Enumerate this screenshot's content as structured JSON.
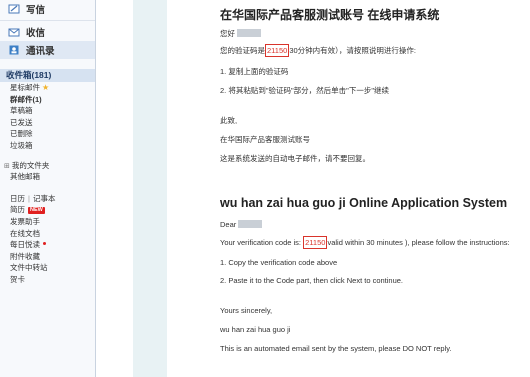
{
  "sidebar": {
    "actions": [
      {
        "label": "写信",
        "icon": "compose-icon"
      },
      {
        "label": "收信",
        "icon": "receive-icon"
      },
      {
        "label": "通讯录",
        "icon": "contacts-icon"
      }
    ],
    "inbox_label": "收件箱(181)",
    "folders": [
      {
        "label": "星标邮件",
        "starred": true
      },
      {
        "label": "群邮件(1)",
        "bold": true
      },
      {
        "label": "草稿箱"
      },
      {
        "label": "已发送"
      },
      {
        "label": "已删除"
      },
      {
        "label": "垃圾箱"
      }
    ],
    "my_folders_label": "我的文件夹",
    "other_mailbox_label": "其他邮箱",
    "tools": {
      "calendar": "日历",
      "notepad": "记事本",
      "resume": "简历",
      "new_badge": "NEW",
      "mail_assistant": "发票助手",
      "online_docs": "在线文档",
      "daily_read": "每日悦读",
      "attachments": "附件收藏",
      "file_transfer": "文件中转站",
      "cards": "贺卡"
    }
  },
  "email": {
    "cn": {
      "title": "在华国际产品客服测试账号 在线申请系统",
      "greeting": "您好",
      "code_prefix": "您的验证码是",
      "code": "21150",
      "code_suffix": "30分钟内有效），请按照说明进行操作:",
      "step1": "1. 复制上面的验证码",
      "step2": "2. 将其粘贴到\"验证码\"部分，然后单击\"下一步\"继续",
      "closing": "此致,",
      "signature": "在华国际产品客服测试账号",
      "auto_note": "这是系统发送的自动电子邮件，请不要回复。"
    },
    "en": {
      "title": "wu han zai hua guo ji Online Application System",
      "greeting": "Dear",
      "code_prefix": "Your verification code is:",
      "code": "21150",
      "code_suffix": "valid within 30 minutes ), please follow the instructions:",
      "step1": "1. Copy the verification code above",
      "step2": "2. Paste it to the Code part, then click Next to continue.",
      "closing": "Yours sincerely,",
      "signature": "wu han zai hua guo ji",
      "auto_note": "This is an automated email sent by the system, please DO NOT reply."
    }
  }
}
